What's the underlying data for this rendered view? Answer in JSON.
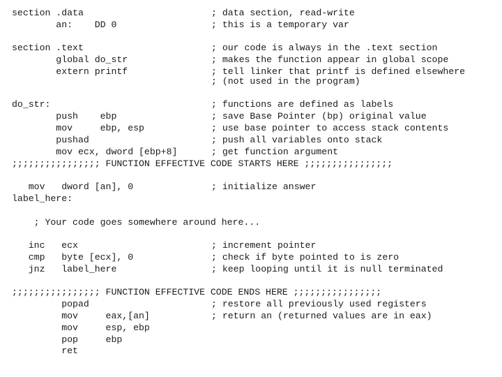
{
  "lines": [
    {
      "code": "section .data",
      "comment": "; data section, read-write"
    },
    {
      "code": "        an:    DD 0",
      "comment": "; this is a temporary var"
    },
    {
      "code": "section .text",
      "comment": "; our code is always in the .text section"
    },
    {
      "code": "        global do_str",
      "comment": "; makes the function appear in global scope"
    },
    {
      "code": "        extern printf",
      "comment": "; tell linker that printf is defined elsewhere"
    },
    {
      "code": "",
      "comment": "; (not used in the program)"
    },
    {
      "code": "do_str:",
      "comment": "; functions are defined as labels"
    },
    {
      "code": "        push    ebp",
      "comment": "; save Base Pointer (bp) original value"
    },
    {
      "code": "        mov     ebp, esp",
      "comment": "; use base pointer to access stack contents"
    },
    {
      "code": "        pushad",
      "comment": "; push all variables onto stack"
    },
    {
      "code": "        mov ecx, dword [ebp+8]",
      "comment": "; get function argument"
    },
    {
      "code": ";;;;;;;;;;;;;;;; FUNCTION EFFECTIVE CODE STARTS HERE ;;;;;;;;;;;;;;;;",
      "comment": ""
    },
    {
      "code": "   mov   dword [an], 0",
      "comment": "; initialize answer"
    },
    {
      "code": "label_here:",
      "comment": ""
    },
    {
      "code": "    ; Your code goes somewhere around here...",
      "comment": ""
    },
    {
      "code": "   inc   ecx",
      "comment": "; increment pointer"
    },
    {
      "code": "   cmp   byte [ecx], 0",
      "comment": "; check if byte pointed to is zero"
    },
    {
      "code": "   jnz   label_here",
      "comment": "; keep looping until it is null terminated"
    },
    {
      "code": ";;;;;;;;;;;;;;;; FUNCTION EFFECTIVE CODE ENDS HERE ;;;;;;;;;;;;;;;;",
      "comment": ""
    },
    {
      "code": "         popad",
      "comment": "; restore all previously used registers"
    },
    {
      "code": "         mov     eax,[an]",
      "comment": "; return an (returned values are in eax)"
    },
    {
      "code": "         mov     esp, ebp",
      "comment": ""
    },
    {
      "code": "         pop     ebp",
      "comment": ""
    },
    {
      "code": "         ret",
      "comment": ""
    }
  ]
}
